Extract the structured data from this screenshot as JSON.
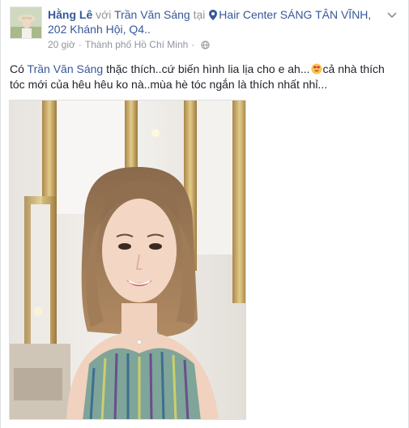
{
  "post": {
    "author": "Hằng Lê",
    "with_word": "với",
    "tagged_friend": "Trần Văn Sáng",
    "at_word": "tại",
    "location_line1": "Hair Center SÁNG TÂN VĨNH,",
    "location_line2": "202 Khánh Hội, Q4..",
    "time": "20 giờ",
    "city": "Thành phố Hồ Chí Minh",
    "text_prefix": "Có",
    "text_mention": "Trần Văn Sáng",
    "text_part1": "thặc thích..cứ biến hình lia lịa cho e ah...",
    "text_part2": "cả nhà thích tóc mới của hêu hêu ko nà..mùa hè tóc ngắn là thích nhất nhỉ...",
    "icons": {
      "location": "location-pin-icon",
      "privacy": "globe-icon",
      "emoji": "heart-eyes-emoji",
      "menu": "chevron-down-icon"
    },
    "colors": {
      "link": "#365899",
      "muted": "#90949c",
      "text": "#1d2129"
    }
  }
}
